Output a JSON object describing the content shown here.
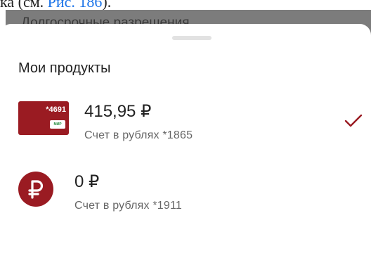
{
  "background_doc": {
    "text_prefix": "ка (см. ",
    "link_text": "Рис. 186",
    "text_suffix": ")."
  },
  "dimmed_header": {
    "title": "Долгосрочные разрешения"
  },
  "sheet": {
    "title": "Мои продукты",
    "products": [
      {
        "thumbnail": "bank-card-icon",
        "card_number": "*4691",
        "payment_system": "МИР",
        "amount": "415,95 ₽",
        "subtitle": "Счет в рублях *1865",
        "selected": true
      },
      {
        "thumbnail": "ruble-icon",
        "amount": "0 ₽",
        "subtitle": "Счет в рублях *1911",
        "selected": false
      }
    ]
  },
  "colors": {
    "accent": "#9a1b22",
    "text_primary": "#222222",
    "text_secondary": "#666666",
    "handle": "#e2e2e2",
    "overlay": "#7c7c7c"
  }
}
